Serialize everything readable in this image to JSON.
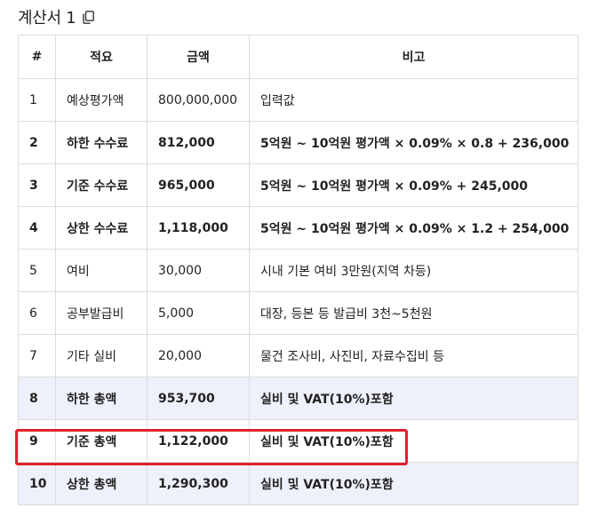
{
  "title": "계산서 1",
  "copy_icon": "copy-icon",
  "highlight_color": "#e0202e",
  "table": {
    "headers": [
      "#",
      "적요",
      "금액",
      "비고"
    ],
    "rows": [
      {
        "no": "1",
        "item": "예상평가액",
        "amount": "800,000,000",
        "note": "입력값",
        "bold": false,
        "shaded": false
      },
      {
        "no": "2",
        "item": "하한 수수료",
        "amount": "812,000",
        "note": "5억원 ~ 10억원 평가액 × 0.09% × 0.8 + 236,000",
        "bold": true,
        "shaded": false
      },
      {
        "no": "3",
        "item": "기준 수수료",
        "amount": "965,000",
        "note": "5억원 ~ 10억원 평가액 × 0.09% + 245,000",
        "bold": true,
        "shaded": false
      },
      {
        "no": "4",
        "item": "상한 수수료",
        "amount": "1,118,000",
        "note": "5억원 ~ 10억원 평가액 × 0.09% × 1.2 + 254,000",
        "bold": true,
        "shaded": false
      },
      {
        "no": "5",
        "item": "여비",
        "amount": "30,000",
        "note": "시내 기본 여비 3만원(지역 차등)",
        "bold": false,
        "shaded": false
      },
      {
        "no": "6",
        "item": "공부발급비",
        "amount": "5,000",
        "note": "대장, 등본 등 발급비 3천~5천원",
        "bold": false,
        "shaded": false
      },
      {
        "no": "7",
        "item": "기타 실비",
        "amount": "20,000",
        "note": "물건 조사비, 사진비, 자료수집비 등",
        "bold": false,
        "shaded": false
      },
      {
        "no": "8",
        "item": "하한 총액",
        "amount": "953,700",
        "note": "실비 및 VAT(10%)포함",
        "bold": true,
        "shaded": true
      },
      {
        "no": "9",
        "item": "기준 총액",
        "amount": "1,122,000",
        "note": "실비 및 VAT(10%)포함",
        "bold": true,
        "shaded": false
      },
      {
        "no": "10",
        "item": "상한 총액",
        "amount": "1,290,300",
        "note": "실비 및 VAT(10%)포함",
        "bold": true,
        "shaded": true
      }
    ]
  }
}
